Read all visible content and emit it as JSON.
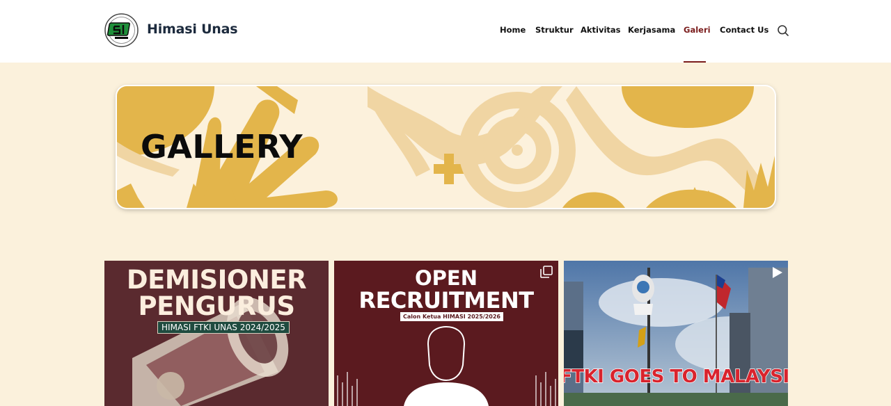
{
  "site": {
    "name": "Himasi Unas",
    "logo_icon": "himasi-logo-icon"
  },
  "nav": {
    "items": [
      {
        "label": "Home"
      },
      {
        "label": "Struktur"
      },
      {
        "label": "Aktivitas"
      },
      {
        "label": "Kerjasama"
      },
      {
        "label": "Galeri"
      },
      {
        "label": "Contact Us"
      }
    ],
    "active": "Galeri",
    "search_icon": "search-icon"
  },
  "banner": {
    "title": "GALLERY"
  },
  "gallery": {
    "items": [
      {
        "headline_1": "DEMISIONER",
        "headline_2": "PENGURUS",
        "tag": "HIMASI FTKI UNAS 2024/2025"
      },
      {
        "headline_1": "OPEN",
        "headline_2": "RECRUITMENT",
        "tag": "Calon Ketua HIMASI 2025/2026",
        "badge_icon": "multiple-images-icon"
      },
      {
        "caption": "FTKI GOES TO MALAYSIA",
        "badge_icon": "play-icon"
      }
    ]
  },
  "colors": {
    "accent": "#7a1c1c",
    "background": "#fbf1dc",
    "header": "#ffffff"
  }
}
